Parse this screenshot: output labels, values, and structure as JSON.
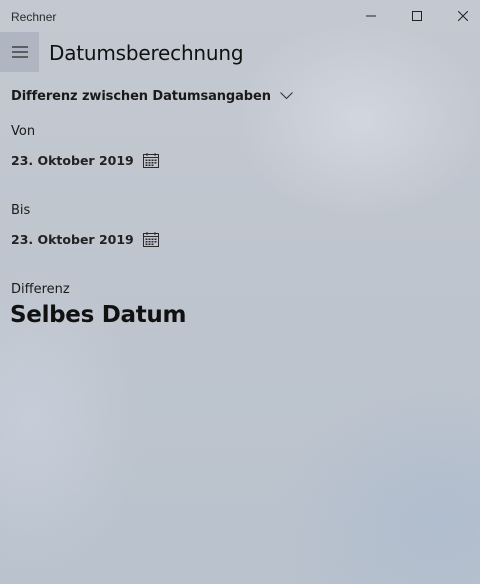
{
  "window": {
    "title": "Rechner",
    "controls": {
      "minimize_icon": "minimize-icon",
      "maximize_icon": "maximize-icon",
      "close_icon": "close-icon"
    }
  },
  "header": {
    "menu_icon": "hamburger-menu-icon",
    "mode_title": "Datumsberechnung"
  },
  "calculation_mode": {
    "selected": "Differenz zwischen Datumsangaben",
    "icon": "chevron-down-icon"
  },
  "from": {
    "label": "Von",
    "date": "23. Oktober 2019",
    "icon": "calendar-icon"
  },
  "to": {
    "label": "Bis",
    "date": "23. Oktober 2019",
    "icon": "calendar-icon"
  },
  "result": {
    "label": "Differenz",
    "value": "Selbes Datum"
  },
  "colors": {
    "background": "#c0c6cf",
    "text": "#1a1a1a",
    "hamburger_bg": "#a5adb8"
  }
}
